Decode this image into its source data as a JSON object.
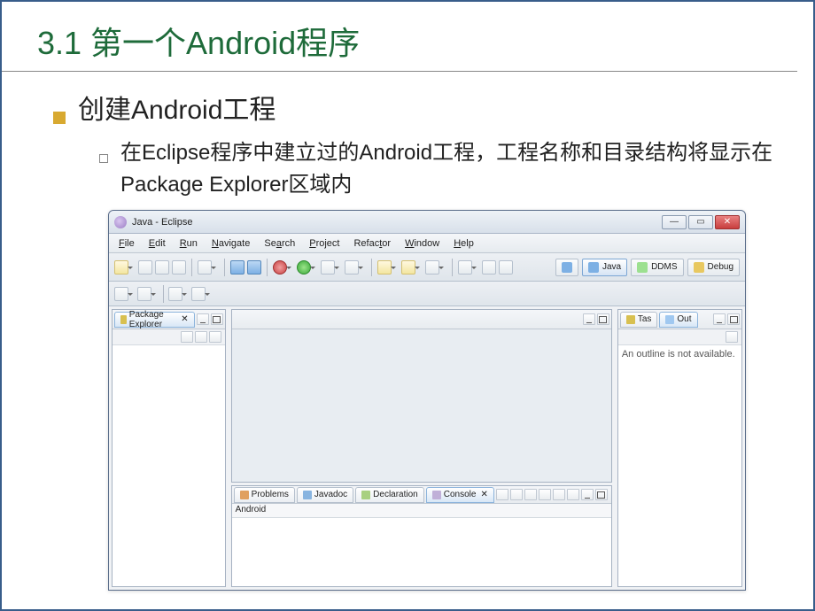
{
  "slide": {
    "title": "3.1  第一个Android程序",
    "h2": "创建Android工程",
    "desc": "在Eclipse程序中建立过的Android工程，工程名称和目录结构将显示在Package Explorer区域内"
  },
  "window": {
    "title": "Java - Eclipse"
  },
  "menu": {
    "file": "File",
    "edit": "Edit",
    "run": "Run",
    "navigate": "Navigate",
    "search": "Search",
    "project": "Project",
    "refactor": "Refactor",
    "window": "Window",
    "help": "Help"
  },
  "perspectives": {
    "java": "Java",
    "ddms": "DDMS",
    "debug": "Debug"
  },
  "panes": {
    "package_explorer": "Package Explorer",
    "tas": "Tas",
    "out": "Out",
    "outline_msg": "An outline is not available.",
    "problems": "Problems",
    "javadoc": "Javadoc",
    "declaration": "Declaration",
    "console": "Console",
    "console_text": "Android"
  }
}
